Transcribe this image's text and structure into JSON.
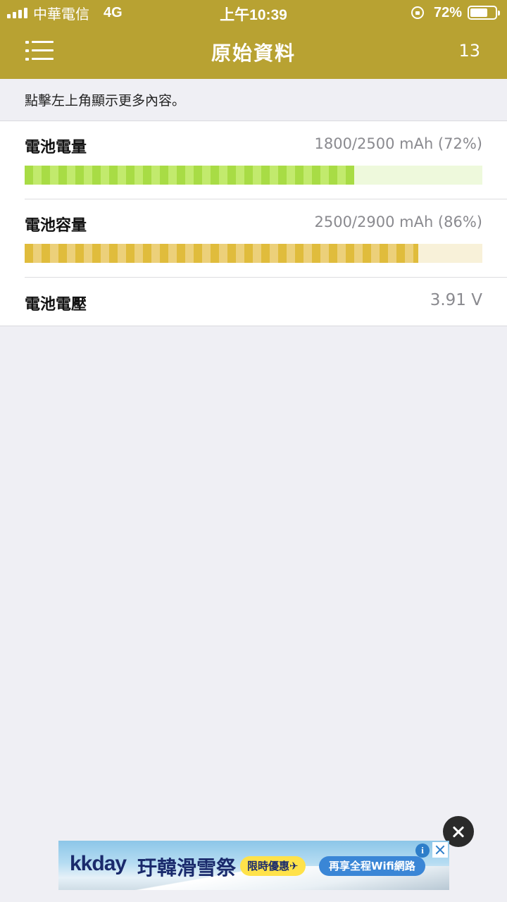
{
  "status_bar": {
    "carrier": "中華電信",
    "network": "4G",
    "time": "上午10:39",
    "battery_percent": "72%",
    "battery_level": 0.72
  },
  "nav": {
    "title": "原始資料",
    "count": "13",
    "menu_icon": "list-menu-icon"
  },
  "hint": "點擊左上角顯示更多內容。",
  "rows": [
    {
      "label": "電池電量",
      "value": "1800/2500 mAh (72%)",
      "level": 0.72,
      "color": "#a8dc45"
    },
    {
      "label": "電池容量",
      "value": "2500/2900 mAh (86%)",
      "level": 0.86,
      "color": "#e0bc3c"
    },
    {
      "label": "電池電壓",
      "value": "3.91 V"
    }
  ],
  "ad": {
    "brand": "kkday",
    "title": "玗韓滑雪祭",
    "badge": "限時優惠✈",
    "subtitle": "再享全程Wifi網路",
    "info_icon": "info-icon",
    "close_icon": "close-icon"
  },
  "colors": {
    "header": "#b8a232",
    "background": "#efeff4"
  }
}
